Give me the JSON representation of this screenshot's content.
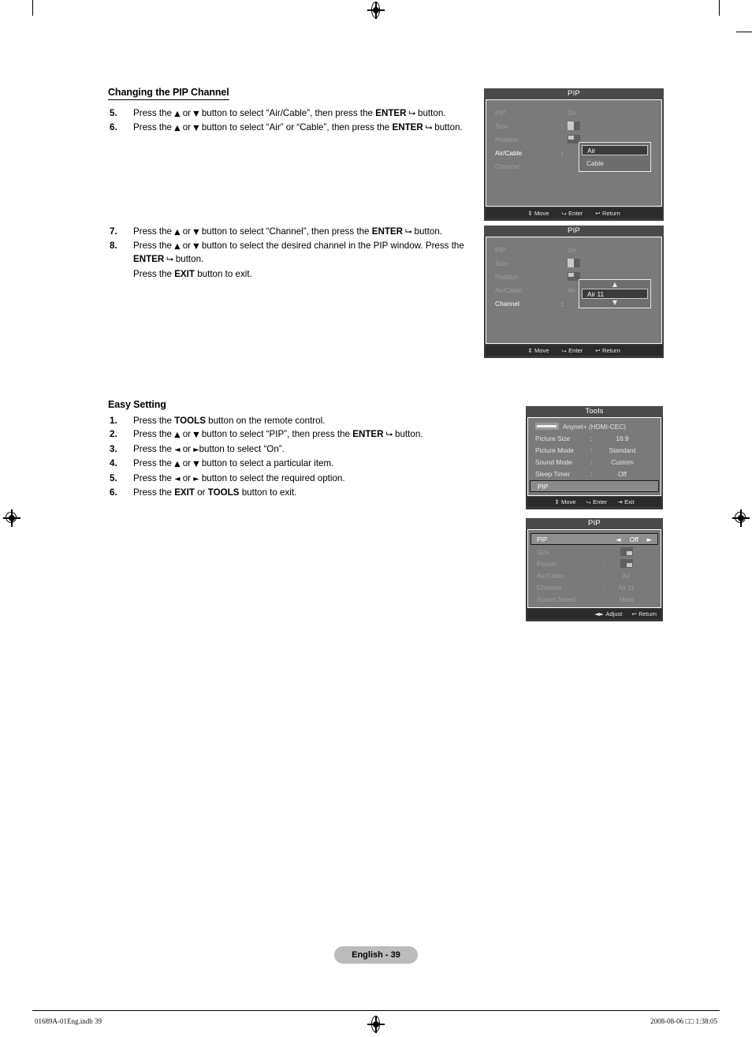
{
  "page": {
    "badge": "English - 39",
    "footer_left": "01689A-01Eng.indb   39",
    "footer_right": "2008-08-06   □□ 1:38:05"
  },
  "section1": {
    "title": "Changing the PIP Channel",
    "steps": [
      {
        "num": "5.",
        "parts": [
          {
            "t": "Press the "
          },
          {
            "t": "▲",
            "s": "arrow"
          },
          {
            "t": " or "
          },
          {
            "t": "▼",
            "s": "arrow"
          },
          {
            "t": " button to select “Air/Cable”, then press the "
          },
          {
            "t": "ENTER",
            "s": "bold"
          },
          {
            "t": " ⮡",
            "s": "ent"
          },
          {
            "t": " button."
          }
        ]
      },
      {
        "num": "6.",
        "parts": [
          {
            "t": "Press the "
          },
          {
            "t": "▲",
            "s": "arrow"
          },
          {
            "t": " or "
          },
          {
            "t": "▼",
            "s": "arrow"
          },
          {
            "t": " button to select “Air” or “Cable”, then press the "
          },
          {
            "t": "ENTER",
            "s": "bold"
          },
          {
            "t": " ⮡",
            "s": "ent"
          },
          {
            "t": " button."
          }
        ]
      }
    ]
  },
  "section2": {
    "steps": [
      {
        "num": "7.",
        "parts": [
          {
            "t": "Press the "
          },
          {
            "t": "▲",
            "s": "arrow"
          },
          {
            "t": " or "
          },
          {
            "t": "▼",
            "s": "arrow"
          },
          {
            "t": " button to select “Channel”, then press the "
          },
          {
            "t": "ENTER",
            "s": "bold"
          },
          {
            "t": " ⮡",
            "s": "ent"
          },
          {
            "t": " button."
          }
        ]
      },
      {
        "num": "8.",
        "parts": [
          {
            "t": "Press the "
          },
          {
            "t": "▲",
            "s": "arrow"
          },
          {
            "t": " or "
          },
          {
            "t": "▼",
            "s": "arrow"
          },
          {
            "t": " button to select the desired channel in the PIP window. Press the "
          },
          {
            "t": "ENTER",
            "s": "bold"
          },
          {
            "t": " ⮡",
            "s": "ent"
          },
          {
            "t": " button."
          }
        ],
        "sub": [
          {
            "t": "Press the "
          },
          {
            "t": "EXIT",
            "s": "bold"
          },
          {
            "t": " button to exit."
          }
        ]
      }
    ]
  },
  "section3": {
    "title": "Easy Setting",
    "steps": [
      {
        "num": "1.",
        "parts": [
          {
            "t": "Press the "
          },
          {
            "t": "TOOLS",
            "s": "bold"
          },
          {
            "t": " button on the remote control."
          }
        ]
      },
      {
        "num": "2.",
        "parts": [
          {
            "t": "Press the "
          },
          {
            "t": "▲",
            "s": "arrow"
          },
          {
            "t": " or "
          },
          {
            "t": "▼",
            "s": "arrow"
          },
          {
            "t": " button to select “PIP”, then press the "
          },
          {
            "t": "ENTER",
            "s": "bold"
          },
          {
            "t": " ⮡",
            "s": "ent"
          },
          {
            "t": " button."
          }
        ]
      },
      {
        "num": "3.",
        "parts": [
          {
            "t": "Press the "
          },
          {
            "t": "◄",
            "s": "arrow"
          },
          {
            "t": " or "
          },
          {
            "t": "►",
            "s": "arrow"
          },
          {
            "t": "button to select “On”."
          }
        ]
      },
      {
        "num": "4.",
        "parts": [
          {
            "t": "Press the "
          },
          {
            "t": "▲",
            "s": "arrow"
          },
          {
            "t": " or "
          },
          {
            "t": "▼",
            "s": "arrow"
          },
          {
            "t": " button to select a particular item."
          }
        ]
      },
      {
        "num": "5.",
        "parts": [
          {
            "t": "Press the "
          },
          {
            "t": "◄",
            "s": "arrow"
          },
          {
            "t": " or "
          },
          {
            "t": "►",
            "s": "arrow"
          },
          {
            "t": " button to select the required option."
          }
        ]
      },
      {
        "num": "6.",
        "parts": [
          {
            "t": "Press the "
          },
          {
            "t": "EXIT",
            "s": "bold"
          },
          {
            "t": " or "
          },
          {
            "t": "TOOLS",
            "s": "bold"
          },
          {
            "t": " button to exit."
          }
        ]
      }
    ]
  },
  "osd1": {
    "title": "PIP",
    "rows": [
      {
        "label": "PIP",
        "colon": ":",
        "value": "On",
        "state": "dim",
        "icon": ""
      },
      {
        "label": "Size",
        "colon": ":",
        "value": "",
        "state": "dim",
        "icon": "size-big"
      },
      {
        "label": "Position",
        "colon": ":",
        "value": "",
        "state": "dim",
        "icon": "position-tl"
      },
      {
        "label": "Air/Cable",
        "colon": ":",
        "value": "",
        "state": "active",
        "icon": ""
      },
      {
        "label": "Channel",
        "colon": ":",
        "value": "",
        "state": "dim",
        "icon": ""
      }
    ],
    "dropdown": {
      "options": [
        "Air",
        "Cable"
      ],
      "selected": "Air"
    },
    "footer": [
      {
        "glyph": "⇕",
        "text": "Move"
      },
      {
        "glyph": "⮡",
        "text": "Enter"
      },
      {
        "glyph": "↩",
        "text": "Return"
      }
    ]
  },
  "osd2": {
    "title": "PIP",
    "rows": [
      {
        "label": "PIP",
        "colon": ":",
        "value": "On",
        "state": "dim",
        "icon": ""
      },
      {
        "label": "Size",
        "colon": ":",
        "value": "",
        "state": "dim",
        "icon": "size-big"
      },
      {
        "label": "Position",
        "colon": ":",
        "value": "",
        "state": "dim",
        "icon": "position-tl"
      },
      {
        "label": "Air/Cable",
        "colon": ":",
        "value": "Air",
        "state": "dim",
        "icon": ""
      },
      {
        "label": "Channel",
        "colon": ":",
        "value": "",
        "state": "active",
        "icon": ""
      }
    ],
    "spinner": {
      "up": "▲",
      "down": "▼",
      "value": "Air 11"
    },
    "footer": [
      {
        "glyph": "⇕",
        "text": "Move"
      },
      {
        "glyph": "⮡",
        "text": "Enter"
      },
      {
        "glyph": "↩",
        "text": "Return"
      }
    ]
  },
  "osd_tools": {
    "title": "Tools",
    "anynet_label": "Anynet+ (HDMI-CEC)",
    "rows": [
      {
        "label": "Picture Size",
        "colon": ":",
        "value": "16:9"
      },
      {
        "label": "Picture Mode",
        "colon": ":",
        "value": "Standard"
      },
      {
        "label": "Sound Mode",
        "colon": ":",
        "value": "Custom"
      },
      {
        "label": "Sleep Timer",
        "colon": ":",
        "value": "Off"
      }
    ],
    "highlight": "PIP",
    "footer": [
      {
        "glyph": "⇕",
        "text": "Move"
      },
      {
        "glyph": "⮡",
        "text": "Enter"
      },
      {
        "glyph": "⇥",
        "text": "Exit"
      }
    ]
  },
  "osd_pip_easy": {
    "title": "PIP",
    "highlight": {
      "label": "PIP",
      "left_arrow": "◄",
      "value": "Off",
      "right_arrow": "►"
    },
    "rows": [
      {
        "label": "Size",
        "colon": ":",
        "value": "",
        "icon": "size-br"
      },
      {
        "label": "Posion",
        "colon": ":",
        "value": "",
        "icon": "position-br"
      },
      {
        "label": "Air/Cable",
        "colon": ":",
        "value": "Air",
        "icon": ""
      },
      {
        "label": "Channel",
        "colon": ":",
        "value": "Air 11",
        "icon": ""
      },
      {
        "label": "Sound Select",
        "colon": ":",
        "value": "Main",
        "icon": ""
      }
    ],
    "footer": [
      {
        "glyph": "◄►",
        "text": "Adjust"
      },
      {
        "glyph": "↩",
        "text": "Return"
      }
    ]
  }
}
